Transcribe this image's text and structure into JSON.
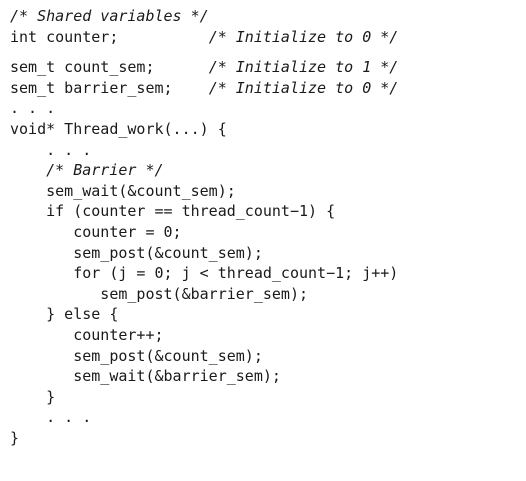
{
  "code_lines": [
    {
      "kind": "comment",
      "text": "/* Shared variables */"
    },
    {
      "kind": "decl",
      "code": "int counter;          ",
      "comment": "/* Initialize to 0 */"
    },
    {
      "kind": "blank"
    },
    {
      "kind": "decl",
      "code": "sem_t count_sem;      ",
      "comment": "/* Initialize to 1 */"
    },
    {
      "kind": "decl",
      "code": "sem_t barrier_sem;    ",
      "comment": "/* Initialize to 0 */"
    },
    {
      "kind": "code",
      "text": ". . ."
    },
    {
      "kind": "code",
      "text": "void* Thread_work(...) {"
    },
    {
      "kind": "code",
      "text": "    . . ."
    },
    {
      "kind": "comment",
      "text": "    /* Barrier */"
    },
    {
      "kind": "code",
      "text": "    sem_wait(&count_sem);"
    },
    {
      "kind": "code",
      "text": "    if (counter == thread_count−1) {"
    },
    {
      "kind": "code",
      "text": "       counter = 0;"
    },
    {
      "kind": "code",
      "text": "       sem_post(&count_sem);"
    },
    {
      "kind": "code",
      "text": "       for (j = 0; j < thread_count−1; j++)"
    },
    {
      "kind": "code",
      "text": "          sem_post(&barrier_sem);"
    },
    {
      "kind": "code",
      "text": "    } else {"
    },
    {
      "kind": "code",
      "text": "       counter++;"
    },
    {
      "kind": "code",
      "text": "       sem_post(&count_sem);"
    },
    {
      "kind": "code",
      "text": "       sem_wait(&barrier_sem);"
    },
    {
      "kind": "code",
      "text": "    }"
    },
    {
      "kind": "code",
      "text": "    . . ."
    },
    {
      "kind": "code",
      "text": "}"
    }
  ]
}
